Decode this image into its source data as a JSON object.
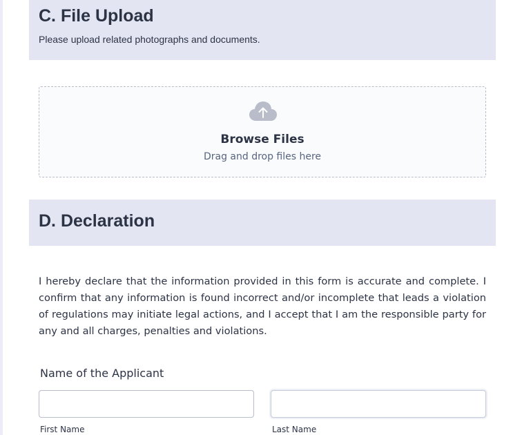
{
  "file_upload": {
    "title": "C. File Upload",
    "subtitle": "Please upload related photographs and documents.",
    "browse_label": "Browse Files",
    "drop_hint": "Drag and drop files here",
    "icon": "cloud-upload-icon"
  },
  "declaration": {
    "title": "D. Declaration",
    "text": "I hereby declare that the information provided in this form is accurate and complete. I confirm that any information is found incorrect and/or incomplete that leads a violation of regulations may initiate legal actions, and I accept that I am the responsible party for any and all charges, penalties and violations."
  },
  "applicant_name": {
    "label": "Name of the Applicant",
    "first_value": "",
    "first_sublabel": "First Name",
    "last_value": "",
    "last_sublabel": "Last Name"
  },
  "colors": {
    "section_bg": "#e3e5f2",
    "text": "#2c3345",
    "icon": "#b8bdc9"
  }
}
